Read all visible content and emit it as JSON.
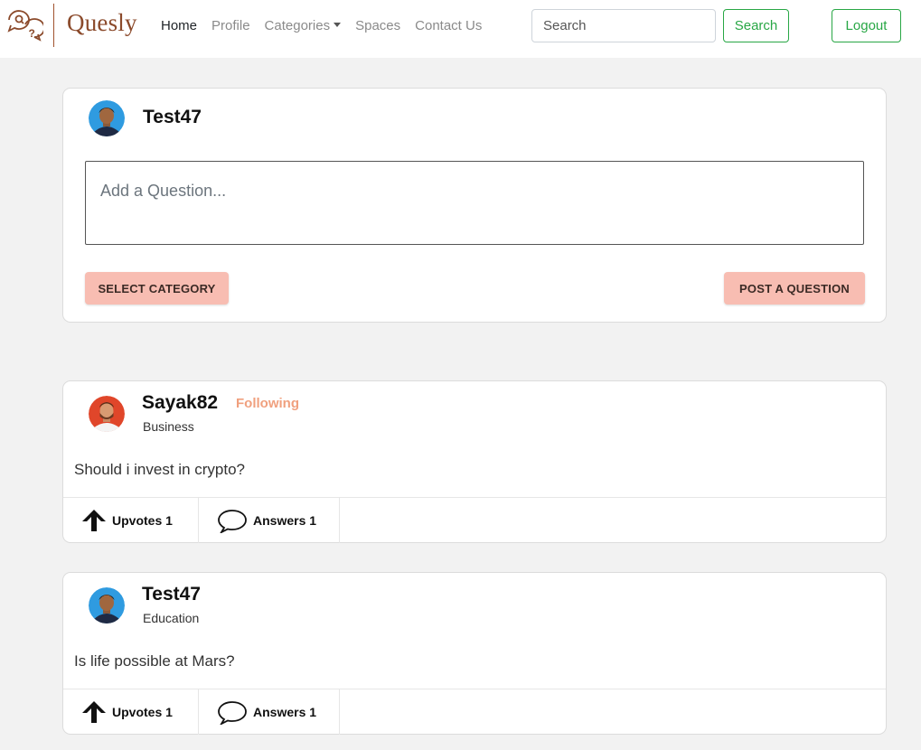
{
  "nav": {
    "brand": "Quesly",
    "links": [
      "Home",
      "Profile",
      "Categories",
      "Spaces",
      "Contact Us"
    ],
    "search_placeholder": "Search",
    "search_button": "Search",
    "logout_button": "Logout"
  },
  "composer": {
    "username": "Test47",
    "placeholder": "Add a Question...",
    "select_category_label": "SELECT CATEGORY",
    "post_button_label": "POST A QUESTION"
  },
  "posts": [
    {
      "username": "Sayak82",
      "following_label": "Following",
      "category": "Business",
      "question": "Should i invest in crypto?",
      "upvotes_label": "Upvotes 1",
      "answers_label": "Answers 1"
    },
    {
      "username": "Test47",
      "category": "Education",
      "question": "Is life possible at Mars?",
      "upvotes_label": "Upvotes 1",
      "answers_label": "Answers 1"
    }
  ],
  "colors": {
    "brand": "#8b4a2b",
    "accent_green": "#28a745",
    "button_pink": "#f8bdb2",
    "following": "#f0a07e"
  },
  "icons": [
    "speech-bubbles-logo-icon",
    "arrow-up-icon",
    "speech-bubble-icon",
    "caret-down-icon"
  ]
}
